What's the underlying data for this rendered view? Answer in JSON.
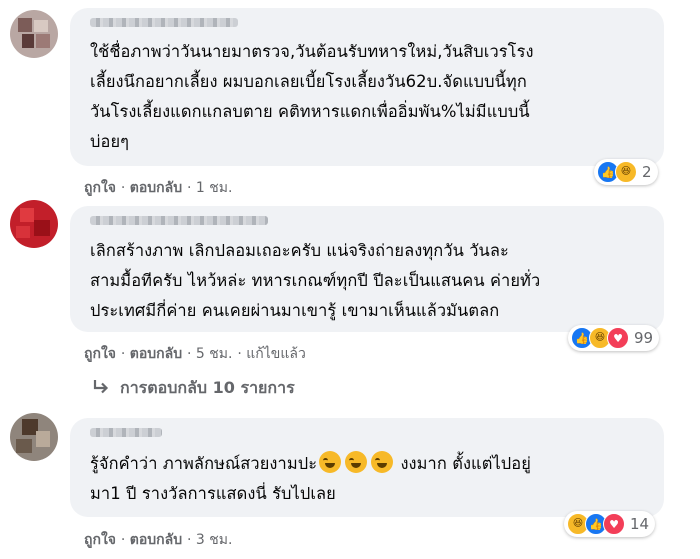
{
  "comments": [
    {
      "lines": [
        "ใช้ชื่อภาพว่าวันนายมาตรวจ,วันต้อนรับทหารใหม่,วันสิบเวรโรง",
        "เลี้ยงนึกอยากเลี้ยง ผมบอกเลยเบี้ยโรงเลี้ยงวัน62บ.จัดแบบนี้ทุก",
        "วันโรงเลี้ยงแดกแกลบตาย คติทหารแดกเพื่ออิ่มพัน%ไม่มีแบบนี้",
        "บ่อยๆ"
      ],
      "like": "ถูกใจ",
      "reply": "ตอบกลับ",
      "time": "1 ชม.",
      "reaction_icons": [
        "like-icon",
        "haha-icon"
      ],
      "reaction_count": "2"
    },
    {
      "lines": [
        "เลิกสร้างภาพ เลิกปลอมเถอะครับ แน่จริงถ่ายลงทุกวัน วันละ",
        "สามมื้อทีครับ ไหว้หล่ะ ทหารเกณฑ์ทุกปี ปีละเป็นแสนคน ค่ายทั่ว",
        "ประเทศมีกี่ค่าย คนเคยผ่านมาเขารู้ เขามาเห็นแล้วมันตลก"
      ],
      "like": "ถูกใจ",
      "reply": "ตอบกลับ",
      "time": "5 ชม.",
      "edited": "แก้ไขแล้ว",
      "reaction_icons": [
        "like-icon",
        "haha-icon",
        "love-icon"
      ],
      "reaction_count": "99",
      "replies_label": "การตอบกลับ 10 รายการ"
    },
    {
      "line1_before": "รู้จักคำว่า ภาพลักษณ์สวยงามปะ",
      "line1_emojis": [
        "rofl-emoji",
        "rofl-emoji",
        "rofl-emoji"
      ],
      "line1_after": " งงมาก ตั้งแต่ไปอยู่",
      "line2": "มา1 ปี รางวัลการแสดงนี่ รับไปเลย",
      "like": "ถูกใจ",
      "reply": "ตอบกลับ",
      "time": "3 ชม.",
      "reaction_icons": [
        "haha-icon",
        "like-icon",
        "love-icon"
      ],
      "reaction_count": "14"
    }
  ],
  "separator": "·",
  "colors": {
    "bubble": "#f0f2f5",
    "secondary_text": "#65676b",
    "like": "#1877f2",
    "haha": "#f7b928",
    "love": "#f33e58"
  }
}
